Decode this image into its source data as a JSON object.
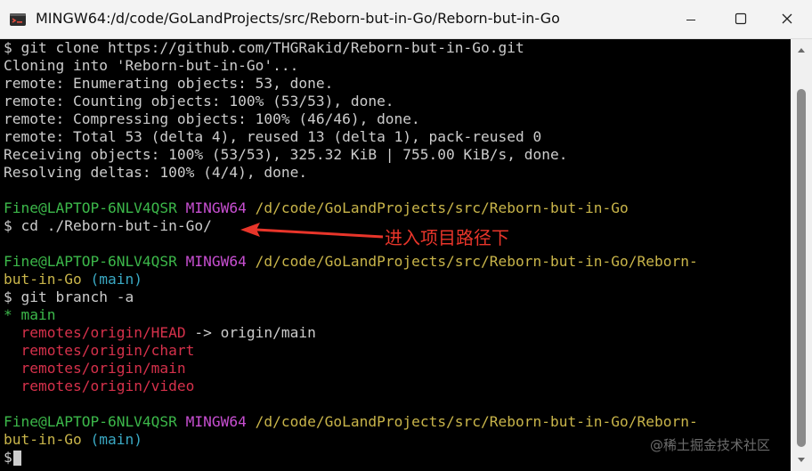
{
  "window": {
    "title": "MINGW64:/d/code/GoLandProjects/src/Reborn-but-in-Go/Reborn-but-in-Go",
    "app_icon": "git-bash-icon",
    "controls": [
      "minimize-icon",
      "maximize-icon",
      "close-icon"
    ]
  },
  "terminal": {
    "lines": [
      {
        "segments": [
          {
            "text": "$ git clone https://github.com/THGRakid/Reborn-but-in-Go.git",
            "color": "white"
          }
        ]
      },
      {
        "segments": [
          {
            "text": "Cloning into 'Reborn-but-in-Go'...",
            "color": "white"
          }
        ]
      },
      {
        "segments": [
          {
            "text": "remote: Enumerating objects: 53, done.",
            "color": "white"
          }
        ]
      },
      {
        "segments": [
          {
            "text": "remote: Counting objects: 100% (53/53), done.",
            "color": "white"
          }
        ]
      },
      {
        "segments": [
          {
            "text": "remote: Compressing objects: 100% (46/46), done.",
            "color": "white"
          }
        ]
      },
      {
        "segments": [
          {
            "text": "remote: Total 53 (delta 4), reused 13 (delta 1), pack-reused 0",
            "color": "white"
          }
        ]
      },
      {
        "segments": [
          {
            "text": "Receiving objects: 100% (53/53), 325.32 KiB | 755.00 KiB/s, done.",
            "color": "white"
          }
        ]
      },
      {
        "segments": [
          {
            "text": "Resolving deltas: 100% (4/4), done.",
            "color": "white"
          }
        ]
      },
      {
        "segments": []
      },
      {
        "segments": [
          {
            "text": "Fine@LAPTOP-6NLV4QSR",
            "color": "green"
          },
          {
            "text": " ",
            "color": "white"
          },
          {
            "text": "MINGW64",
            "color": "magenta"
          },
          {
            "text": " ",
            "color": "white"
          },
          {
            "text": "/d/code/GoLandProjects/src/Reborn-but-in-Go",
            "color": "yellow"
          }
        ]
      },
      {
        "segments": [
          {
            "text": "$ cd ./Reborn-but-in-Go/",
            "color": "white"
          }
        ]
      },
      {
        "segments": []
      },
      {
        "segments": [
          {
            "text": "Fine@LAPTOP-6NLV4QSR",
            "color": "green"
          },
          {
            "text": " ",
            "color": "white"
          },
          {
            "text": "MINGW64",
            "color": "magenta"
          },
          {
            "text": " ",
            "color": "white"
          },
          {
            "text": "/d/code/GoLandProjects/src/Reborn-but-in-Go/Reborn-",
            "color": "yellow"
          }
        ]
      },
      {
        "segments": [
          {
            "text": "but-in-Go",
            "color": "yellow"
          },
          {
            "text": " ",
            "color": "white"
          },
          {
            "text": "(main)",
            "color": "cyan"
          }
        ]
      },
      {
        "segments": [
          {
            "text": "$ git branch -a",
            "color": "white"
          }
        ]
      },
      {
        "segments": [
          {
            "text": "* main",
            "color": "green"
          }
        ]
      },
      {
        "segments": [
          {
            "text": "  ",
            "color": "white"
          },
          {
            "text": "remotes/origin/HEAD",
            "color": "red"
          },
          {
            "text": " -> origin/main",
            "color": "white"
          }
        ]
      },
      {
        "segments": [
          {
            "text": "  ",
            "color": "white"
          },
          {
            "text": "remotes/origin/chart",
            "color": "red"
          }
        ]
      },
      {
        "segments": [
          {
            "text": "  ",
            "color": "white"
          },
          {
            "text": "remotes/origin/main",
            "color": "red"
          }
        ]
      },
      {
        "segments": [
          {
            "text": "  ",
            "color": "white"
          },
          {
            "text": "remotes/origin/video",
            "color": "red"
          }
        ]
      },
      {
        "segments": []
      },
      {
        "segments": [
          {
            "text": "Fine@LAPTOP-6NLV4QSR",
            "color": "green"
          },
          {
            "text": " ",
            "color": "white"
          },
          {
            "text": "MINGW64",
            "color": "magenta"
          },
          {
            "text": " ",
            "color": "white"
          },
          {
            "text": "/d/code/GoLandProjects/src/Reborn-but-in-Go/Reborn-",
            "color": "yellow"
          }
        ]
      },
      {
        "segments": [
          {
            "text": "but-in-Go",
            "color": "yellow"
          },
          {
            "text": " ",
            "color": "white"
          },
          {
            "text": "(main)",
            "color": "cyan"
          }
        ]
      },
      {
        "segments": [
          {
            "text": "$",
            "color": "white"
          }
        ],
        "cursor": true
      }
    ]
  },
  "annotation": {
    "text": "进入项目路径下",
    "color": "#e8352a"
  },
  "watermark": {
    "text": "@稀土掘金技术社区"
  },
  "colors": {
    "green": "#3cb84a",
    "magenta": "#c84fd2",
    "yellow": "#c9b54a",
    "cyan": "#3aa9c4",
    "red": "#d6314b",
    "white": "#cccccc"
  }
}
